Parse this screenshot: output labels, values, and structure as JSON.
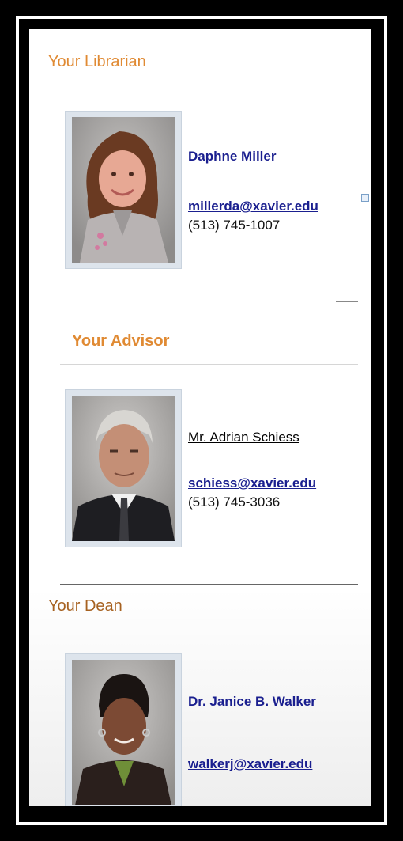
{
  "librarian": {
    "heading": "Your Librarian",
    "name": "Daphne Miller",
    "email": "millerda@xavier.edu",
    "phone": "(513) 745-1007",
    "photo_icon": "librarian-photo"
  },
  "advisor": {
    "heading": "Your Advisor",
    "name": "Mr. Adrian Schiess",
    "email": "schiess@xavier.edu",
    "phone": "(513) 745-3036",
    "photo_icon": "advisor-photo"
  },
  "dean": {
    "heading": "Your Dean",
    "name": "Dr. Janice B. Walker",
    "email": "walkerj@xavier.edu",
    "photo_icon": "dean-photo"
  },
  "colors": {
    "heading": "#e08a33",
    "link": "#1a1f8f"
  }
}
